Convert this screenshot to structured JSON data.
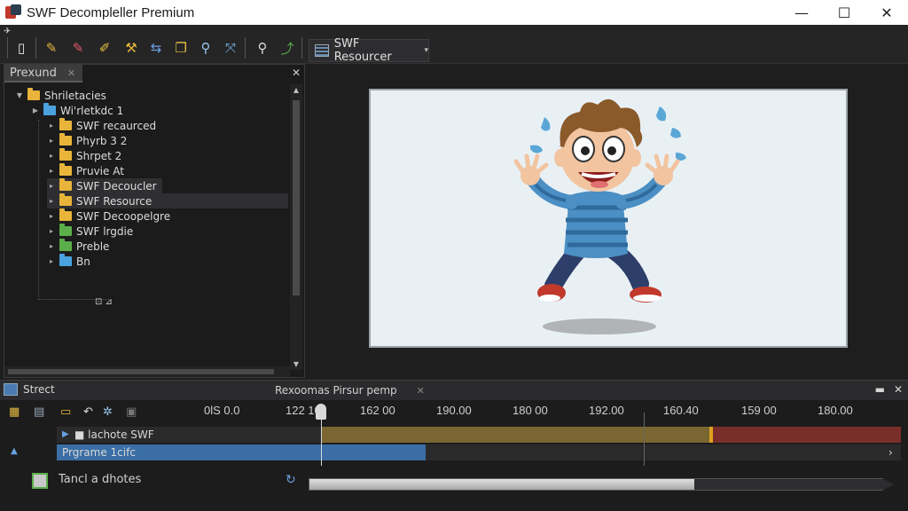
{
  "window": {
    "title": "SWF Decompleller Premium",
    "controls": {
      "minimize": "—",
      "maximize": "☐",
      "close": "✕"
    }
  },
  "toolbar": {
    "corner_glyph": "✈",
    "resource_dropdown": "SWF Resourcer",
    "icons": [
      "new-file-icon",
      "pencil-icon",
      "eraser-icon",
      "brush-icon",
      "hammer-icon",
      "link-icon",
      "folder-copy-icon",
      "search-icon",
      "crop-icon",
      "zoom-icon",
      "export-icon"
    ]
  },
  "left_panel": {
    "tab_label": "Prexund",
    "close": "✕",
    "tree": [
      {
        "label": "Shriletacies",
        "color": "gold"
      },
      {
        "label": "Wi'rletkdc 1",
        "color": "blue"
      },
      {
        "label": "SWF recaurced",
        "color": "gold"
      },
      {
        "label": "Phyrb 3 2",
        "color": "gold"
      },
      {
        "label": "Shrpet 2",
        "color": "gold"
      },
      {
        "label": "Pruvie At",
        "color": "gold"
      },
      {
        "label": "SWF Decoucler",
        "color": "gold"
      },
      {
        "label": "SWF Resource",
        "color": "gold"
      },
      {
        "label": "SWF Decoopelgre",
        "color": "gold"
      },
      {
        "label": "SWF lrgdie",
        "color": "green"
      },
      {
        "label": "Preble",
        "color": "green"
      },
      {
        "label": "Bn",
        "color": "blue"
      }
    ],
    "tree_tail": "⊡ ⊿"
  },
  "timeline": {
    "tab_label": "Strect",
    "panel_title": "Rexoomas Pirsur pemp",
    "close": "✕",
    "ruler": [
      "0lS 0.0",
      "122 10",
      "162 00",
      "190.00",
      "180 00",
      "192.00",
      "160.40",
      "159 00",
      "180.00"
    ],
    "tracks": [
      {
        "label": "lachote SWF",
        "color": "#7a6630"
      },
      {
        "label": "Prgrame 1cifc",
        "color": "#3a6ea5"
      }
    ],
    "task_label": "Tancl a dhotes",
    "progress_fraction": 0.66,
    "min_glyph": "▬",
    "expand_glyph": "▲",
    "track_arrow": "›"
  }
}
